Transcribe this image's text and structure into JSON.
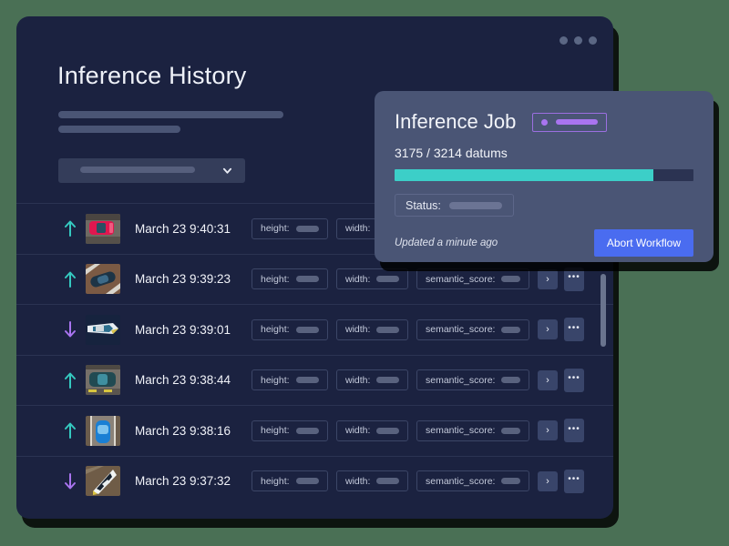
{
  "window": {
    "title": "Inference History",
    "dots": [
      "window-dot",
      "window-dot",
      "window-dot"
    ],
    "filter_select": {
      "placeholder": "",
      "chevron": "chevron-down-icon"
    }
  },
  "table": {
    "columns": [
      "direction",
      "thumbnail",
      "timestamp",
      "height",
      "width",
      "semantic_score",
      "open",
      "more"
    ],
    "tag_labels": {
      "height": "height:",
      "width": "width:",
      "semantic": "semantic_score:"
    },
    "actions": {
      "open": "›",
      "more": "•••"
    },
    "rows": [
      {
        "direction": "up",
        "timestamp": "March 23 9:40:31",
        "thumb": "red-car-aerial",
        "has_semantic": false
      },
      {
        "direction": "up",
        "timestamp": "March 23 9:39:23",
        "thumb": "dark-blue-car-aerial",
        "has_semantic": true
      },
      {
        "direction": "down",
        "timestamp": "March 23 9:39:01",
        "thumb": "boat-on-water-aerial",
        "has_semantic": true
      },
      {
        "direction": "up",
        "timestamp": "March 23 9:38:44",
        "thumb": "teal-car-parking-lot",
        "has_semantic": true
      },
      {
        "direction": "up",
        "timestamp": "March 23 9:38:16",
        "thumb": "blue-car-road-aerial",
        "has_semantic": true
      },
      {
        "direction": "down",
        "timestamp": "March 23 9:37:32",
        "thumb": "white-boat-aerial",
        "has_semantic": true
      }
    ]
  },
  "panel": {
    "title": "Inference Job",
    "badge": {
      "dot": "status-dot",
      "redacted": true
    },
    "datums": "3175 / 3214 datums",
    "progress_percent": 86.5,
    "status_label": "Status:",
    "updated": "Updated a minute ago",
    "abort_label": "Abort Workflow"
  },
  "colors": {
    "background": "#4a7055",
    "window": "#1b2240",
    "panel": "#4a5575",
    "accent_teal": "#3ccfc8",
    "accent_purple": "#a974f0",
    "accent_blue": "#4a6cf0",
    "divider": "#2b3352"
  }
}
